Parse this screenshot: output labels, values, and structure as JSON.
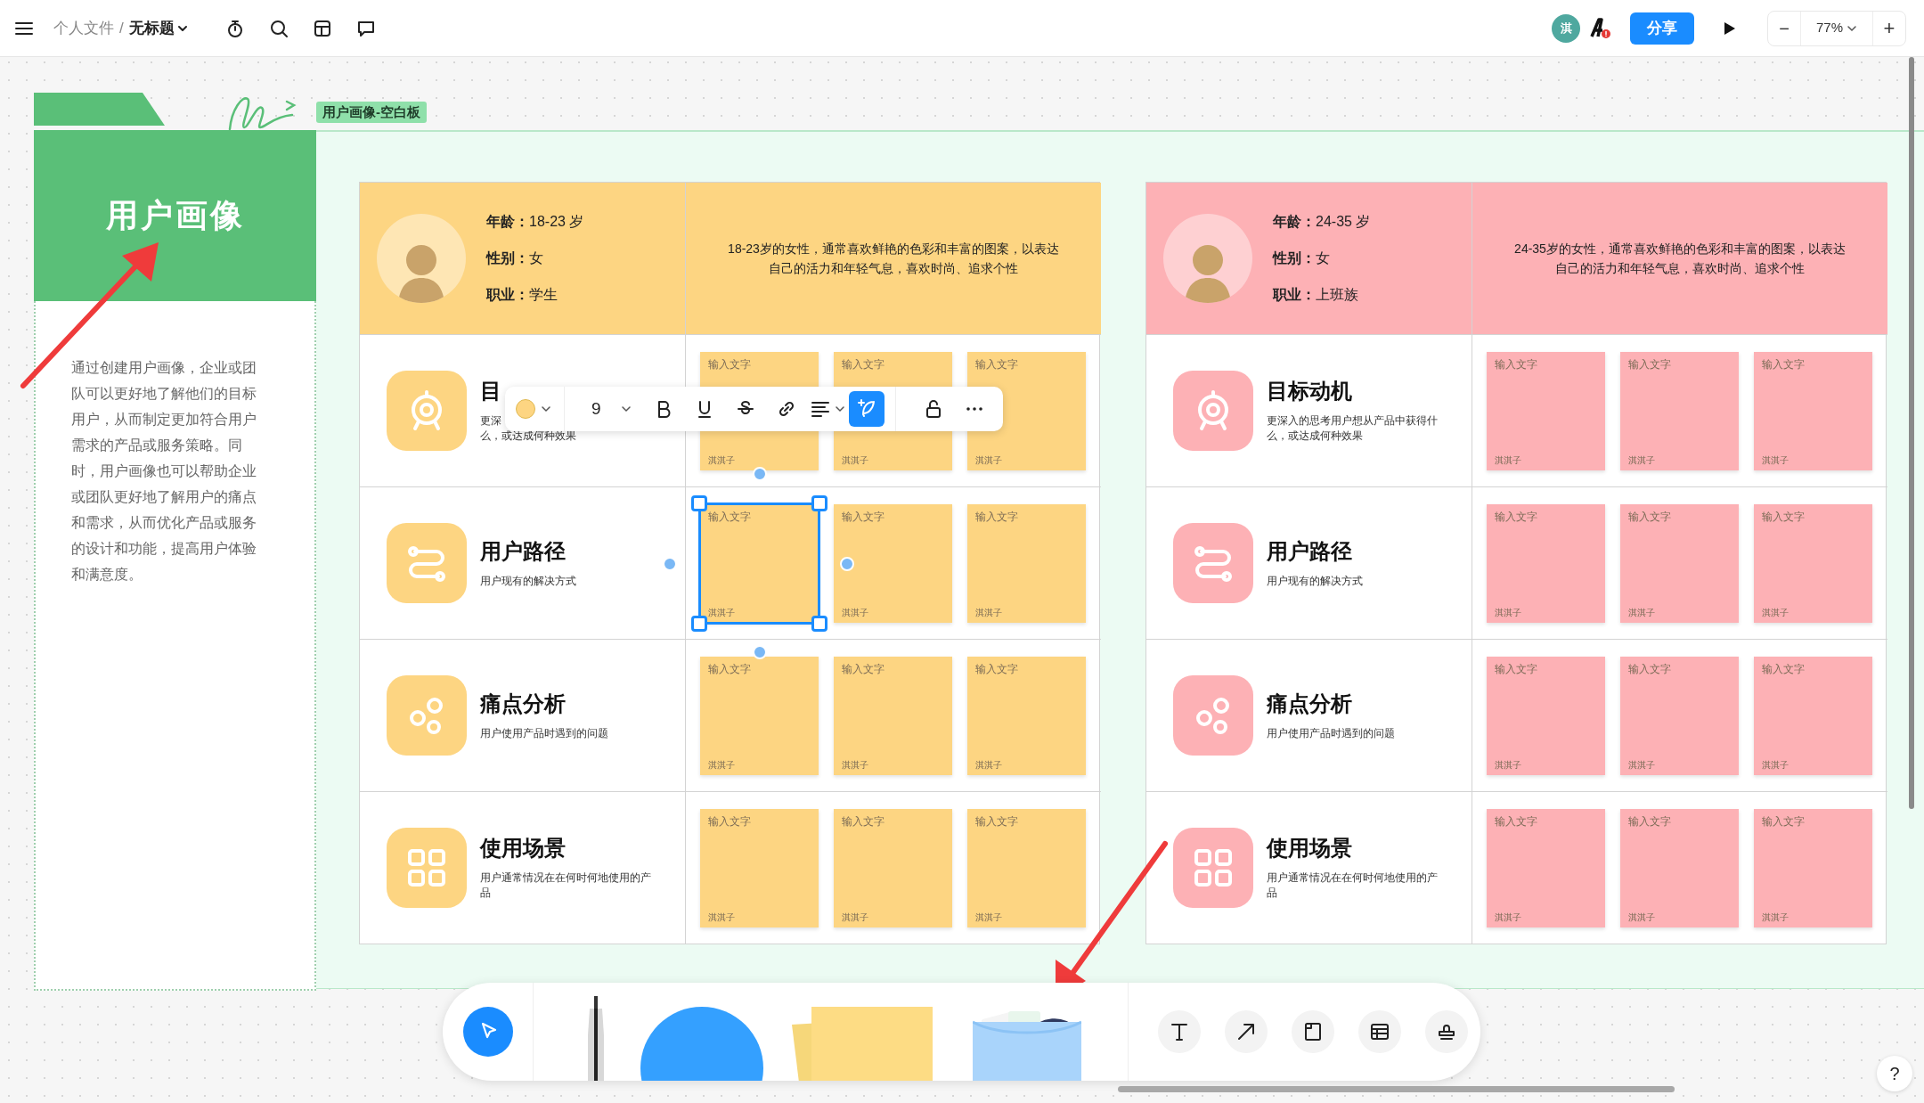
{
  "topbar": {
    "breadcrumb": [
      "个人文件",
      "无标题"
    ],
    "separator": "/",
    "avatar_initial": "淇",
    "share": "分享",
    "zoom": "77%",
    "zoom_out": "−",
    "zoom_in": "+"
  },
  "frame": {
    "label": "用户画像-空白板",
    "title": "用户画像",
    "description_lines": [
      "通过创建用户画像，企业或团",
      "队可以更好地了解他们的目标",
      "用户，从而制定更加符合用户",
      "需求的产品或服务策略。同",
      "时，用户画像也可以帮助企业",
      "或团队更好地了解用户的痛点",
      "和需求，从而优化产品或服务",
      "的设计和功能，提高用户体验",
      "和满意度。"
    ]
  },
  "personas": [
    {
      "color": "#fdd582",
      "fields": [
        {
          "label": "年龄：",
          "value": "18-23 岁"
        },
        {
          "label": "性别：",
          "value": "女"
        },
        {
          "label": "职业：",
          "value": "学生"
        }
      ],
      "summary_lines": [
        "18-23岁的女性，通常喜欢鲜艳的色彩和丰富的图案，以表达",
        "自己的活力和年轻气息，喜欢时尚、追求个性"
      ],
      "rows": [
        {
          "kind": "target",
          "title": "目",
          "description_lines": [
            "更深",
            "么，或达成何种效果"
          ],
          "notes": [
            {
              "text": "输入文字",
              "author": "淇淇子",
              "selected": false
            },
            {
              "text": "输入文字",
              "author": "淇淇子",
              "selected": false
            },
            {
              "text": "输入文字",
              "author": "淇淇子",
              "selected": false
            }
          ]
        },
        {
          "kind": "path",
          "title": "用户路径",
          "description_lines": [
            "用户现有的解决方式"
          ],
          "notes": [
            {
              "text": "输入文字",
              "author": "淇淇子",
              "selected": true
            },
            {
              "text": "输入文字",
              "author": "淇淇子",
              "selected": false
            },
            {
              "text": "输入文字",
              "author": "淇淇子",
              "selected": false
            }
          ]
        },
        {
          "kind": "pain",
          "title": "痛点分析",
          "description_lines": [
            "用户使用产品时遇到的问题"
          ],
          "notes": [
            {
              "text": "输入文字",
              "author": "淇淇子",
              "selected": false
            },
            {
              "text": "输入文字",
              "author": "淇淇子",
              "selected": false
            },
            {
              "text": "输入文字",
              "author": "淇淇子",
              "selected": false
            }
          ]
        },
        {
          "kind": "scene",
          "title": "使用场景",
          "description_lines": [
            "用户通常情况在在何时何地使用的产",
            "品"
          ],
          "notes": [
            {
              "text": "输入文字",
              "author": "淇淇子",
              "selected": false
            },
            {
              "text": "输入文字",
              "author": "淇淇子",
              "selected": false
            },
            {
              "text": "输入文字",
              "author": "淇淇子",
              "selected": false
            }
          ]
        }
      ]
    },
    {
      "color": "#fdb1b5",
      "fields": [
        {
          "label": "年龄：",
          "value": "24-35 岁"
        },
        {
          "label": "性别：",
          "value": "女"
        },
        {
          "label": "职业：",
          "value": "上班族"
        }
      ],
      "summary_lines": [
        "24-35岁的女性，通常喜欢鲜艳的色彩和丰富的图案，以表达",
        "自己的活力和年轻气息，喜欢时尚、追求个性"
      ],
      "rows": [
        {
          "kind": "target",
          "title": "目标动机",
          "description_lines": [
            "更深入的思考用户想从产品中获得什",
            "么，或达成何种效果"
          ],
          "notes": [
            {
              "text": "输入文字",
              "author": "淇淇子",
              "selected": false
            },
            {
              "text": "输入文字",
              "author": "淇淇子",
              "selected": false
            },
            {
              "text": "输入文字",
              "author": "淇淇子",
              "selected": false
            }
          ]
        },
        {
          "kind": "path",
          "title": "用户路径",
          "description_lines": [
            "用户现有的解决方式"
          ],
          "notes": [
            {
              "text": "输入文字",
              "author": "淇淇子",
              "selected": false
            },
            {
              "text": "输入文字",
              "author": "淇淇子",
              "selected": false
            },
            {
              "text": "输入文字",
              "author": "淇淇子",
              "selected": false
            }
          ]
        },
        {
          "kind": "pain",
          "title": "痛点分析",
          "description_lines": [
            "用户使用产品时遇到的问题"
          ],
          "notes": [
            {
              "text": "输入文字",
              "author": "淇淇子",
              "selected": false
            },
            {
              "text": "输入文字",
              "author": "淇淇子",
              "selected": false
            },
            {
              "text": "输入文字",
              "author": "淇淇子",
              "selected": false
            }
          ]
        },
        {
          "kind": "scene",
          "title": "使用场景",
          "description_lines": [
            "用户通常情况在在何时何地使用的产",
            "品"
          ],
          "notes": [
            {
              "text": "输入文字",
              "author": "淇淇子",
              "selected": false
            },
            {
              "text": "输入文字",
              "author": "淇淇子",
              "selected": false
            },
            {
              "text": "输入文字",
              "author": "淇淇子",
              "selected": false
            }
          ]
        }
      ]
    }
  ],
  "format_toolbar": {
    "font_size": "9",
    "tools": [
      {
        "kind": "bold",
        "selected": false
      },
      {
        "kind": "underline",
        "selected": false
      },
      {
        "kind": "strike",
        "selected": false
      },
      {
        "kind": "link",
        "selected": false
      },
      {
        "kind": "align",
        "selected": false
      },
      {
        "kind": "feather",
        "selected": true
      },
      {
        "kind": "lock",
        "selected": false
      },
      {
        "kind": "more",
        "selected": false
      }
    ]
  },
  "bottom_toolbar": {
    "tools": [
      {
        "kind": "select",
        "selected": true
      },
      {
        "kind": "text",
        "selected": false
      },
      {
        "kind": "arrow",
        "selected": false
      },
      {
        "kind": "frame",
        "selected": false
      },
      {
        "kind": "table",
        "selected": false
      },
      {
        "kind": "stamp",
        "selected": false
      }
    ]
  },
  "help": "?"
}
